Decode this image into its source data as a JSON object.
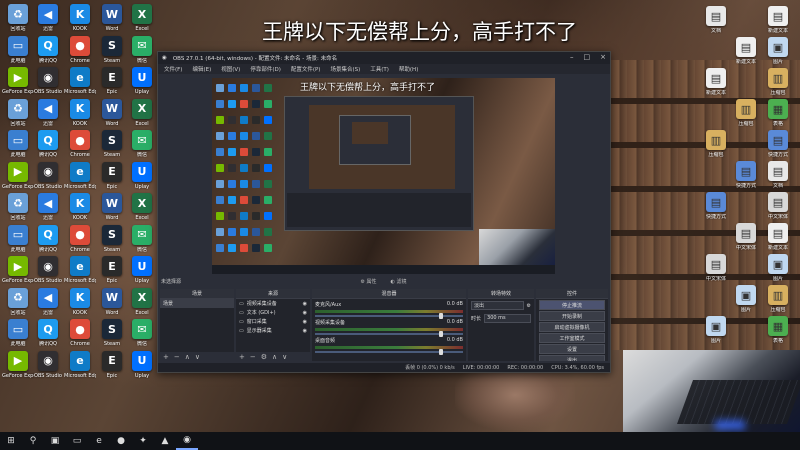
{
  "overlay_caption": "王牌以下无偿帮上分，高手打不了",
  "obs": {
    "title": "OBS 27.0.1 (64-bit, windows) - 配置文件: 未命名 - 场景: 未命名",
    "menu": [
      "文件(F)",
      "编辑(E)",
      "视图(V)",
      "停靠部件(D)",
      "配置文件(P)",
      "场景集合(S)",
      "工具(T)",
      "帮助(H)"
    ],
    "source_label": "未选择源",
    "preview_buttons": [
      "属性",
      "滤镜"
    ],
    "preview_caption": "王牌以下无偿帮上分，高手打不了",
    "docks": {
      "scenes": {
        "title": "场景",
        "items": [
          "场景"
        ]
      },
      "sources": {
        "title": "来源",
        "items": [
          "视频采集设备",
          "文本 (GDI+)",
          "窗口采集",
          "显示器采集"
        ]
      },
      "mixer": {
        "title": "混音器",
        "channels": [
          {
            "name": "麦克风/Aux",
            "level": "0.0 dB"
          },
          {
            "name": "视频采集设备",
            "level": "0.0 dB"
          },
          {
            "name": "桌面音频",
            "level": "0.0 dB"
          }
        ]
      },
      "transitions": {
        "title": "转场特效",
        "type": "淡出",
        "duration_label": "时长",
        "duration": "300 ms"
      },
      "controls": {
        "title": "控件",
        "buttons": [
          "停止推流",
          "开始录制",
          "启动虚拟摄像机",
          "工作室模式",
          "设置",
          "退出"
        ]
      }
    },
    "status": {
      "live": "LIVE: 00:00:00",
      "rec": "REC: 00:00:00",
      "cpu": "CPU: 3.4%, 60.00 fps",
      "bitrate": "丢帧 0 (0.0%)  0 kb/s"
    }
  },
  "desktop_icons": [
    {
      "label": "回收站",
      "color": "#6aa0d8",
      "glyph": "♻"
    },
    {
      "label": "迅雷",
      "color": "#2a7be0",
      "glyph": "◀"
    },
    {
      "label": "KOOK",
      "color": "#1a8ae5",
      "glyph": "K"
    },
    {
      "label": "Word",
      "color": "#2b579a",
      "glyph": "W"
    },
    {
      "label": "Excel",
      "color": "#217346",
      "glyph": "X"
    },
    {
      "label": "此电脑",
      "color": "#3a7fd0",
      "glyph": "▭"
    },
    {
      "label": "腾讯QQ",
      "color": "#1d9bf0",
      "glyph": "Q"
    },
    {
      "label": "Chrome",
      "color": "#dd4b39",
      "glyph": "●"
    },
    {
      "label": "Steam",
      "color": "#1b2838",
      "glyph": "S"
    },
    {
      "label": "微信",
      "color": "#2aae67",
      "glyph": "✉"
    },
    {
      "label": "GeForce Experience",
      "color": "#76b900",
      "glyph": "▶"
    },
    {
      "label": "OBS Studio",
      "color": "#302e31",
      "glyph": "◉"
    },
    {
      "label": "Microsoft Edge",
      "color": "#0f7bc7",
      "glyph": "e"
    },
    {
      "label": "Epic",
      "color": "#2a2a2a",
      "glyph": "E"
    },
    {
      "label": "Uplay",
      "color": "#0070ff",
      "glyph": "U"
    }
  ],
  "right_icons": [
    {
      "label": "文档",
      "color": "#e8e8e8",
      "glyph": "▤"
    },
    {
      "label": "中文宋体",
      "color": "#d8d8d8",
      "glyph": "▤"
    },
    {
      "label": "新建文本",
      "color": "#efefef",
      "glyph": "▤"
    },
    {
      "label": "图片",
      "color": "#c0d8f0",
      "glyph": "▣"
    },
    {
      "label": "压缩包",
      "color": "#d8b060",
      "glyph": "▥"
    },
    {
      "label": "表格",
      "color": "#4caf50",
      "glyph": "▦"
    },
    {
      "label": "快捷方式",
      "color": "#5a8ad8",
      "glyph": "▤"
    }
  ],
  "taskbar": {
    "icons": [
      {
        "name": "start-icon",
        "glyph": "⊞"
      },
      {
        "name": "search-icon",
        "glyph": "⚲"
      },
      {
        "name": "task-view-icon",
        "glyph": "▣"
      },
      {
        "name": "file-explorer-icon",
        "glyph": "▭"
      },
      {
        "name": "edge-icon",
        "glyph": "e"
      },
      {
        "name": "chrome-icon",
        "glyph": "●"
      },
      {
        "name": "feishu-icon",
        "glyph": "✦"
      },
      {
        "name": "app-icon",
        "glyph": "▲"
      },
      {
        "name": "obs-icon",
        "glyph": "◉"
      }
    ]
  },
  "colors": {
    "accent": "#7aa7ff",
    "obs_bg": "#2b2e38",
    "taskbar": "#101216"
  }
}
